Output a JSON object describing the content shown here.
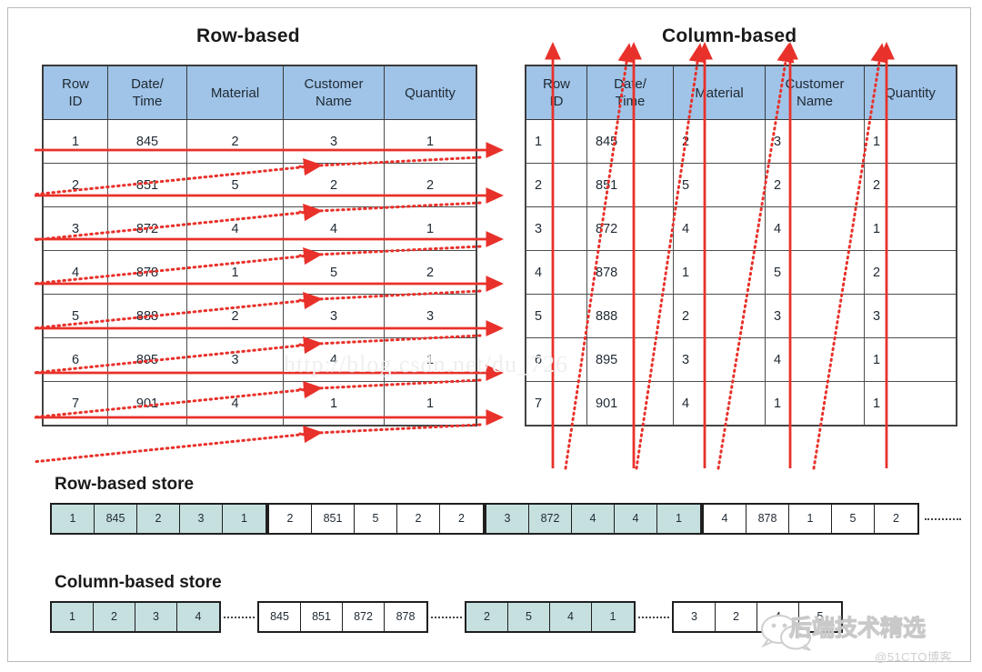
{
  "diagram": {
    "left_title": "Row-based",
    "right_title": "Column-based",
    "row_store_title": "Row-based store",
    "column_store_title": "Column-based store"
  },
  "table": {
    "headers": [
      "Row ID",
      "Date/ Time",
      "Material",
      "Customer Name",
      "Quantity"
    ],
    "header_lines": [
      [
        "Row",
        "ID"
      ],
      [
        "Date/",
        "Time"
      ],
      [
        "Material",
        ""
      ],
      [
        "Customer",
        "Name"
      ],
      [
        "Quantity",
        ""
      ]
    ],
    "rows": [
      [
        "1",
        "845",
        "2",
        "3",
        "1"
      ],
      [
        "2",
        "851",
        "5",
        "2",
        "2"
      ],
      [
        "3",
        "872",
        "4",
        "4",
        "1"
      ],
      [
        "4",
        "878",
        "1",
        "5",
        "2"
      ],
      [
        "5",
        "888",
        "2",
        "3",
        "3"
      ],
      [
        "6",
        "895",
        "3",
        "4",
        "1"
      ],
      [
        "7",
        "901",
        "4",
        "1",
        "1"
      ]
    ]
  },
  "row_store": {
    "groups": [
      {
        "shade": "teal",
        "cells": [
          "1",
          "845",
          "2",
          "3",
          "1"
        ]
      },
      {
        "shade": "white",
        "cells": [
          "2",
          "851",
          "5",
          "2",
          "2"
        ]
      },
      {
        "shade": "teal",
        "cells": [
          "3",
          "872",
          "4",
          "4",
          "1"
        ]
      },
      {
        "shade": "white",
        "cells": [
          "4",
          "878",
          "1",
          "5",
          "2"
        ]
      }
    ],
    "continues": true
  },
  "column_store": {
    "groups": [
      {
        "shade": "teal",
        "cells": [
          "1",
          "2",
          "3",
          "4"
        ]
      },
      {
        "shade": "white",
        "cells": [
          "845",
          "851",
          "872",
          "878"
        ]
      },
      {
        "shade": "teal",
        "cells": [
          "2",
          "5",
          "4",
          "1"
        ]
      },
      {
        "shade": "white",
        "cells": [
          "3",
          "2",
          "4",
          "5"
        ]
      }
    ],
    "continues": false
  },
  "colors": {
    "header_blue": "#a0c4e8",
    "store_teal": "#c6e0e0",
    "arrow_red": "#e8312a",
    "border_dark": "#3a3a3a"
  },
  "watermarks": {
    "url": "http://blog.csdn.net/du_726",
    "wechat": "后端技术精选",
    "site": "@51CTO博客"
  }
}
